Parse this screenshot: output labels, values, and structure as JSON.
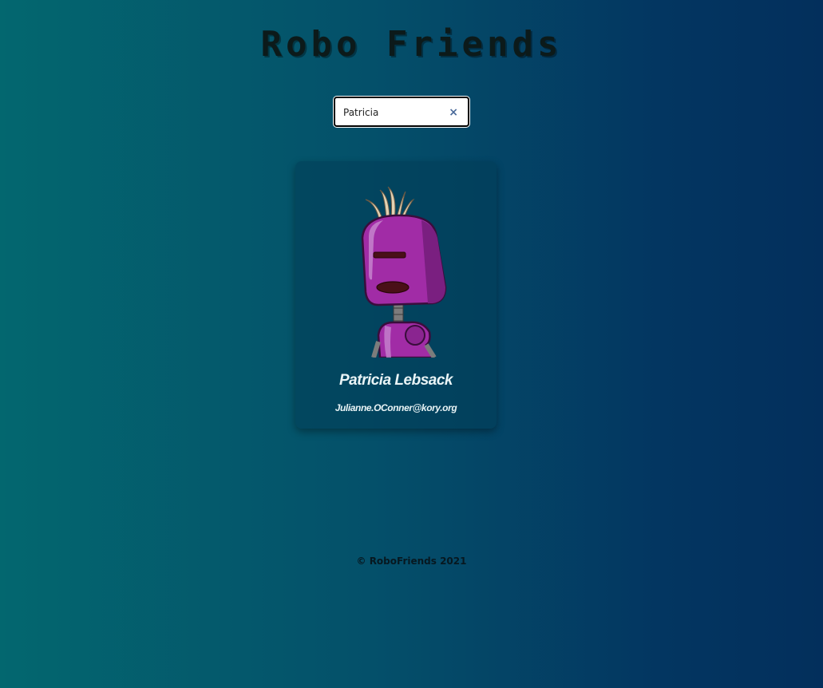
{
  "header": {
    "title": "Robo Friends"
  },
  "search": {
    "value": "Patricia",
    "clear_icon": "×"
  },
  "results": [
    {
      "name": "Patricia Lebsack",
      "email": "Julianne.OConner@kory.org",
      "avatar_icon": "robot-avatar"
    }
  ],
  "footer": {
    "text": "© RoboFriends 2021"
  },
  "colors": {
    "background_left": "#03676f",
    "background_right": "#032f5c",
    "robot_body": "#9b2aa0"
  }
}
